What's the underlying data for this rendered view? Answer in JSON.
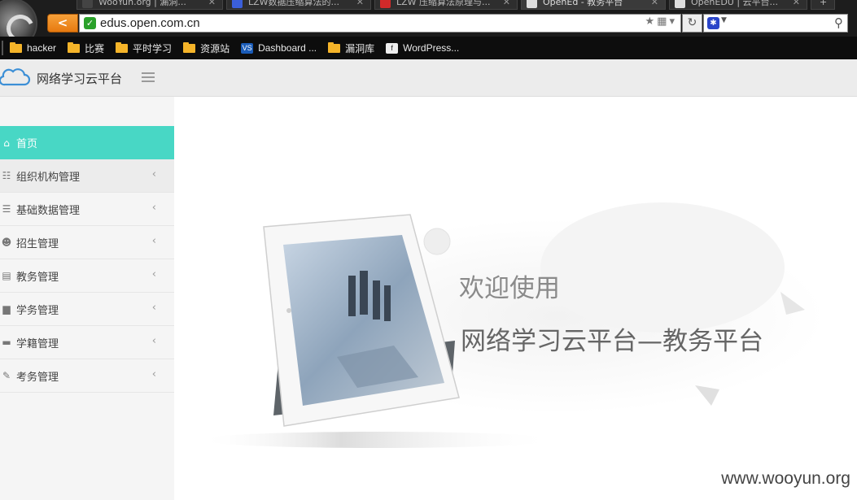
{
  "browser": {
    "tabs": [
      {
        "label": "WooYun.org | 漏洞...",
        "active": false,
        "icon": "wooyun-icon"
      },
      {
        "label": "LZW数据压缩算法的...",
        "active": false,
        "icon": "page-icon"
      },
      {
        "label": "LZW 压缩算法原理与...",
        "active": false,
        "icon": "pdf-icon"
      },
      {
        "label": "OpenEd - 教务平台",
        "active": true,
        "icon": "doc-icon"
      },
      {
        "label": "OpenEDU | 云平台...",
        "active": false,
        "icon": "doc-icon"
      }
    ],
    "new_tab_label": "+",
    "url": "edus.open.com.cn",
    "back_label": "<",
    "bookmarks": [
      {
        "label": "hacker",
        "icon": "folder-icon"
      },
      {
        "label": "比赛",
        "icon": "folder-icon"
      },
      {
        "label": "平时学习",
        "icon": "folder-icon"
      },
      {
        "label": "资源站",
        "icon": "folder-icon"
      },
      {
        "label": "Dashboard ...",
        "icon": "dashboard-icon"
      },
      {
        "label": "漏洞库",
        "icon": "folder-icon"
      },
      {
        "label": "WordPress...",
        "icon": "wordpress-icon"
      }
    ]
  },
  "app": {
    "title": "网络学习云平台",
    "accent_color": "#48d7c5"
  },
  "sidebar": {
    "items": [
      {
        "label": "首页",
        "icon": "home-icon",
        "active": true
      },
      {
        "label": "组织机构管理",
        "icon": "sitemap-icon",
        "active": false
      },
      {
        "label": "基础数据管理",
        "icon": "database-icon",
        "active": false
      },
      {
        "label": "招生管理",
        "icon": "users-icon",
        "active": false
      },
      {
        "label": "教务管理",
        "icon": "server-icon",
        "active": false
      },
      {
        "label": "学务管理",
        "icon": "file-icon",
        "active": false
      },
      {
        "label": "学籍管理",
        "icon": "folder-icon",
        "active": false
      },
      {
        "label": "考务管理",
        "icon": "edit-icon",
        "active": false
      }
    ],
    "chevron": "‹"
  },
  "main": {
    "welcome": "欢迎使用",
    "platform_title": "网络学习云平台—教务平台",
    "watermark": "www.wooyun.org"
  }
}
